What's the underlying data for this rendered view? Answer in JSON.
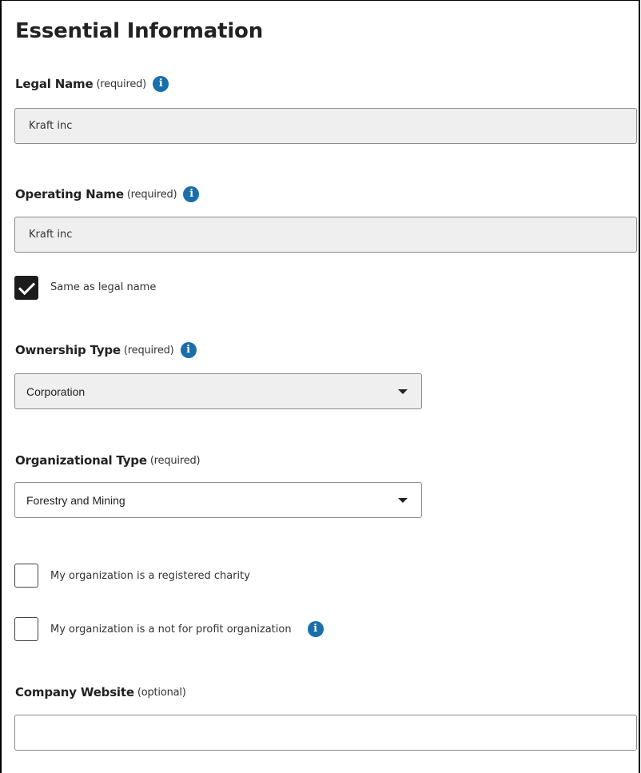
{
  "title": "Essential Information",
  "legal_name": {
    "label": "Legal Name",
    "qualifier": "(required)",
    "value": "Kraft inc",
    "info_icon": "info-icon"
  },
  "operating_name": {
    "label": "Operating Name",
    "qualifier": "(required)",
    "value": "Kraft inc",
    "info_icon": "info-icon",
    "same_as_legal": {
      "label": "Same as legal name",
      "checked": true
    }
  },
  "ownership_type": {
    "label": "Ownership Type",
    "qualifier": "(required)",
    "selected": "Corporation",
    "info_icon": "info-icon"
  },
  "organizational_type": {
    "label": "Organizational Type",
    "qualifier": "(required)",
    "selected": "Forestry and Mining"
  },
  "registered_charity": {
    "label": "My organization is a registered charity",
    "checked": false
  },
  "not_for_profit": {
    "label": "My organization is a not for profit organization",
    "checked": false,
    "info_icon": "info-icon"
  },
  "company_website": {
    "label": "Company Website",
    "qualifier": "(optional)",
    "value": ""
  },
  "colors": {
    "info_icon": "#1a6eaa",
    "disabled_field_bg": "#efefef",
    "checkbox_checked": "#1c1c1c"
  }
}
